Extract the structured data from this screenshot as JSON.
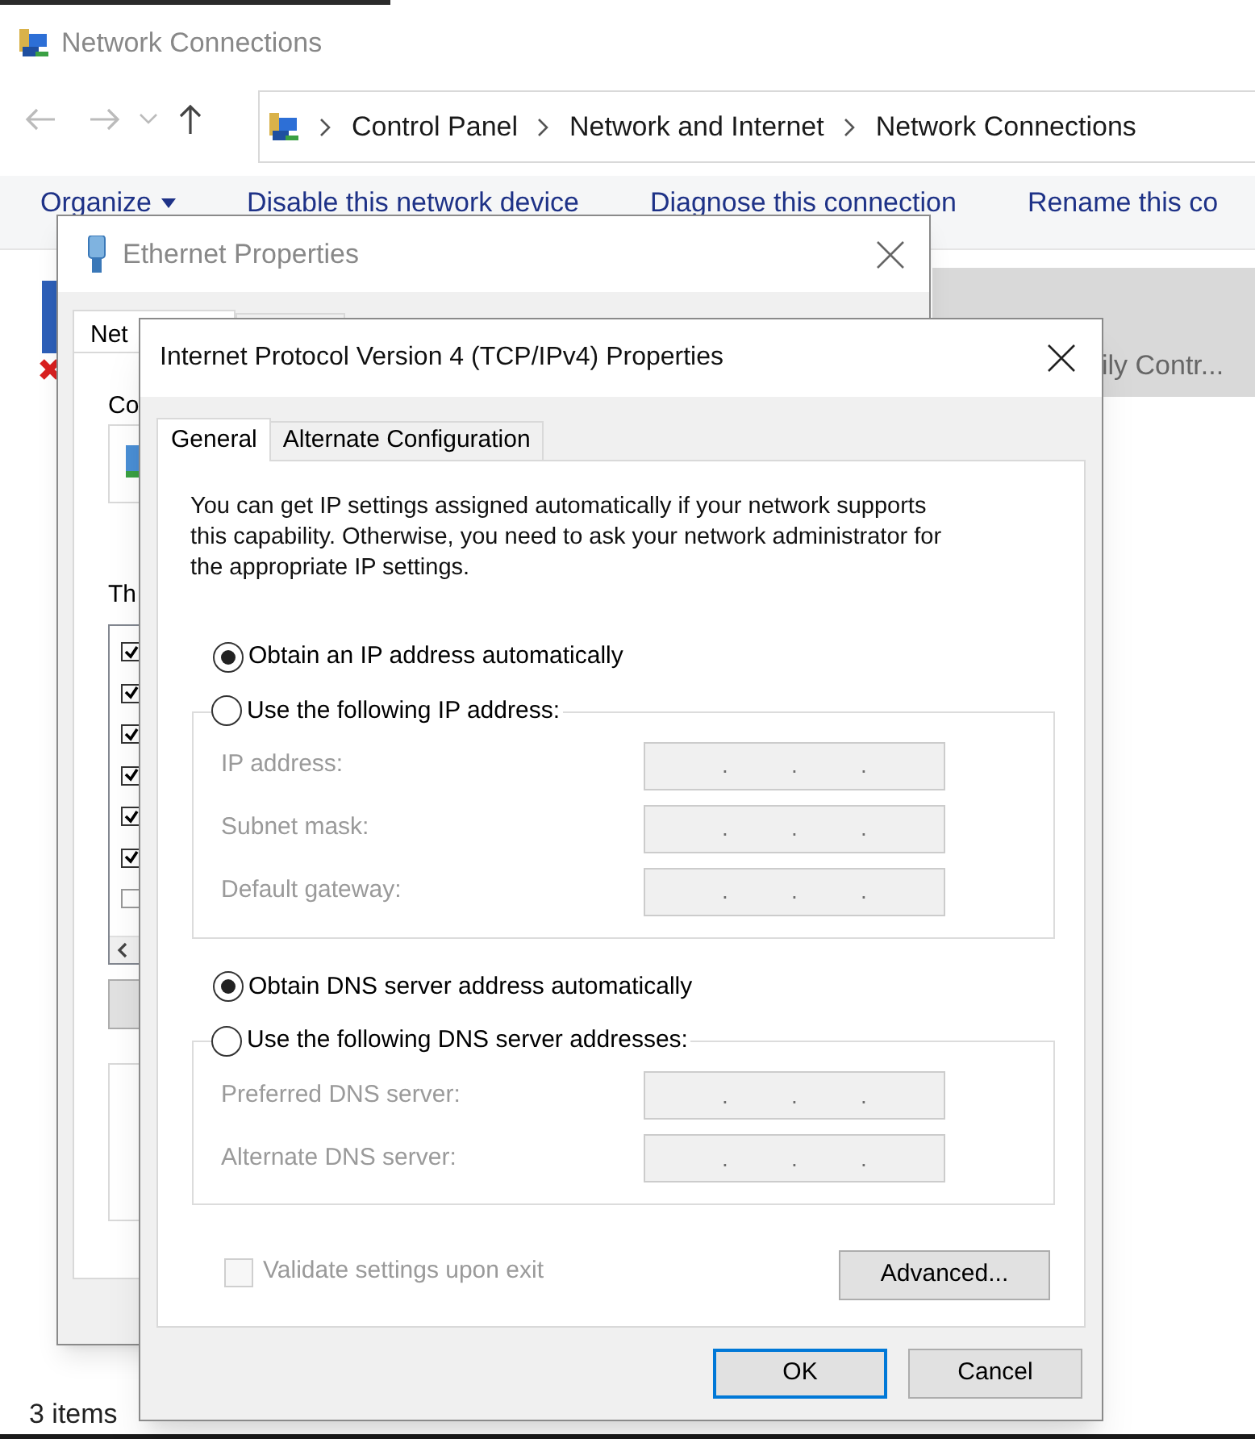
{
  "explorer": {
    "title": "Network Connections",
    "breadcrumb": [
      "Control Panel",
      "Network and Internet",
      "Network Connections"
    ],
    "toolbar": [
      {
        "kind": "menu",
        "label": "Organize"
      },
      {
        "kind": "command",
        "label": "Disable this network device"
      },
      {
        "kind": "command",
        "label": "Diagnose this connection"
      },
      {
        "kind": "command",
        "label": "Rename this co"
      }
    ],
    "item": {
      "label": "ily Contr...",
      "selected": true
    },
    "status": "3 items"
  },
  "ethernet_dialog": {
    "title": "Ethernet Properties",
    "tab": "Net",
    "labels": [
      "Co",
      "Th"
    ],
    "components": [
      {
        "checked": true
      },
      {
        "checked": true
      },
      {
        "checked": true
      },
      {
        "checked": true
      },
      {
        "checked": true
      },
      {
        "checked": true
      },
      {
        "checked": false
      }
    ]
  },
  "ipv4_dialog": {
    "title": "Internet Protocol Version 4 (TCP/IPv4) Properties",
    "tabs": [
      {
        "label": "General",
        "selected": true
      },
      {
        "label": "Alternate Configuration",
        "selected": false
      }
    ],
    "intro": "You can get IP settings assigned automatically if your network supports this capability. Otherwise, you need to ask your network administrator for the appropriate IP settings.",
    "ip_mode": [
      {
        "label": "Obtain an IP address automatically",
        "selected": true
      },
      {
        "label": "Use the following IP address:",
        "selected": false
      }
    ],
    "ip_fields": [
      {
        "label": "IP address:",
        "disabled": true,
        "separators": [
          ".",
          ".",
          "."
        ]
      },
      {
        "label": "Subnet mask:",
        "disabled": true,
        "separators": [
          ".",
          ".",
          "."
        ]
      },
      {
        "label": "Default gateway:",
        "disabled": true,
        "separators": [
          ".",
          ".",
          "."
        ]
      }
    ],
    "dns_mode": [
      {
        "label": "Obtain DNS server address automatically",
        "selected": true
      },
      {
        "label": "Use the following DNS server addresses:",
        "selected": false
      }
    ],
    "dns_fields": [
      {
        "label": "Preferred DNS server:",
        "disabled": true,
        "separators": [
          ".",
          ".",
          "."
        ]
      },
      {
        "label": "Alternate DNS server:",
        "disabled": true,
        "separators": [
          ".",
          ".",
          "."
        ]
      }
    ],
    "validate": {
      "label": "Validate settings upon exit",
      "checked": false,
      "disabled": true
    },
    "advanced_button": "Advanced...",
    "buttons": [
      {
        "label": "OK",
        "default": true
      },
      {
        "label": "Cancel",
        "default": false
      }
    ]
  }
}
